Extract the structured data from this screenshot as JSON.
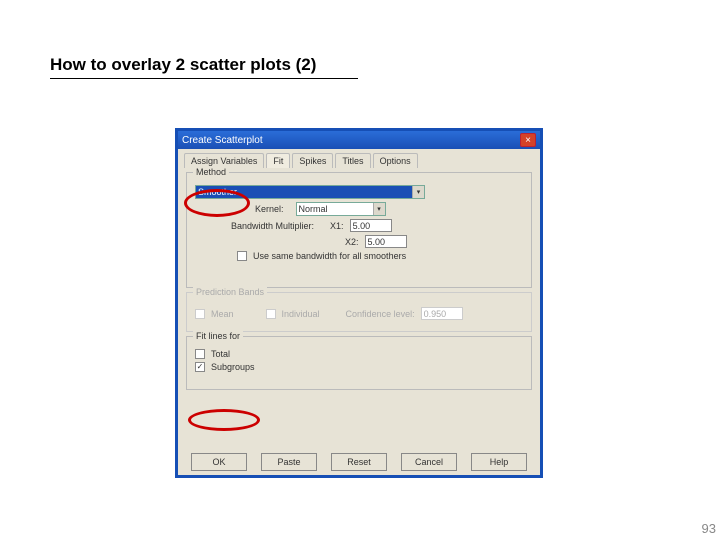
{
  "slide": {
    "title": "How to overlay 2 scatter plots (2)",
    "page_number": "93"
  },
  "dialog": {
    "title": "Create Scatterplot"
  },
  "tabs": {
    "assign": "Assign Variables",
    "fit": "Fit",
    "spikes": "Spikes",
    "titles": "Titles",
    "options": "Options"
  },
  "method_group": {
    "legend": "Method",
    "smoother_value": "Smoother",
    "kernel_label": "Kernel:",
    "kernel_value": "Normal",
    "bandwidth_label": "Bandwidth Multiplier:",
    "x1_label": "X1:",
    "x1_value": "5.00",
    "x2_label": "X2:",
    "x2_value": "5.00",
    "same_bw_label": "Use same bandwidth for all smoothers"
  },
  "prediction_group": {
    "legend": "Prediction Bands",
    "mean_label": "Mean",
    "individual_label": "Individual",
    "conf_label": "Confidence level:",
    "conf_value": "0.950"
  },
  "fitlines_group": {
    "legend": "Fit lines for",
    "total_label": "Total",
    "subgroups_label": "Subgroups"
  },
  "buttons": {
    "ok": "OK",
    "paste": "Paste",
    "reset": "Reset",
    "cancel": "Cancel",
    "help": "Help"
  }
}
